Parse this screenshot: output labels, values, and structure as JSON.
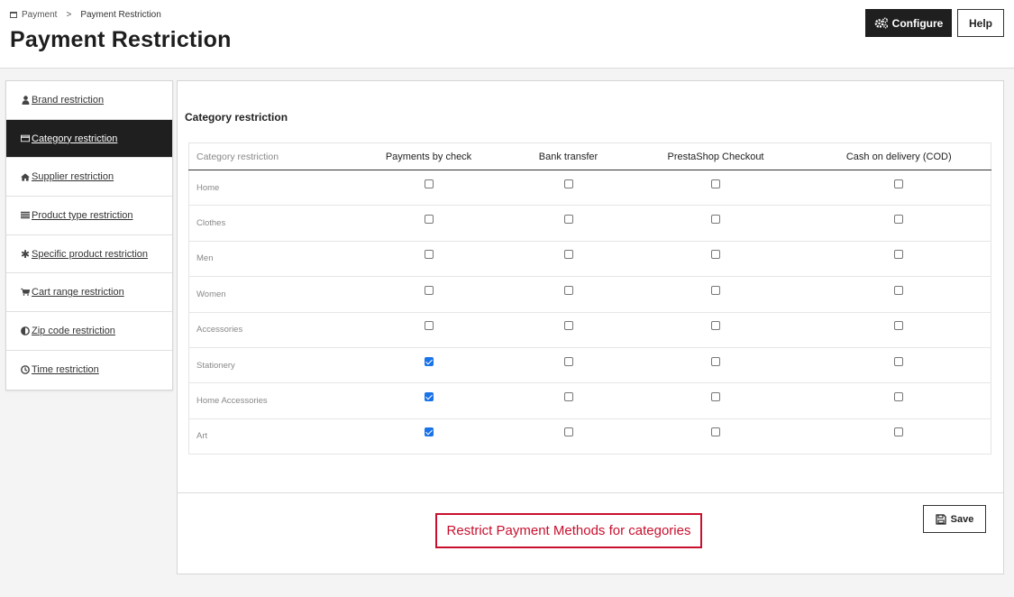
{
  "breadcrumb": {
    "parent": "Payment",
    "separator": ">",
    "current": "Payment Restriction"
  },
  "page_title": "Payment Restriction",
  "toolbar": {
    "configure_label": "Configure",
    "help_label": "Help"
  },
  "sidebar": {
    "items": [
      {
        "label": "Brand restriction",
        "icon": "user-icon",
        "active": false
      },
      {
        "label": "Category restriction",
        "icon": "credit-card-icon",
        "active": true
      },
      {
        "label": "Supplier restriction",
        "icon": "home-icon",
        "active": false
      },
      {
        "label": "Product type restriction",
        "icon": "list-icon",
        "active": false
      },
      {
        "label": "Specific product restriction",
        "icon": "asterisk-icon",
        "active": false
      },
      {
        "label": "Cart range restriction",
        "icon": "cart-icon",
        "active": false
      },
      {
        "label": "Zip code restriction",
        "icon": "half-circle-icon",
        "active": false
      },
      {
        "label": "Time restriction",
        "icon": "clock-icon",
        "active": false
      }
    ]
  },
  "panel": {
    "heading": "Category restriction",
    "columns": [
      "Category restriction",
      "Payments by check",
      "Bank transfer",
      "PrestaShop Checkout",
      "Cash on delivery (COD)"
    ],
    "rows": [
      {
        "name": "Home",
        "checks": [
          false,
          false,
          false,
          false
        ]
      },
      {
        "name": "Clothes",
        "checks": [
          false,
          false,
          false,
          false
        ]
      },
      {
        "name": "Men",
        "checks": [
          false,
          false,
          false,
          false
        ]
      },
      {
        "name": "Women",
        "checks": [
          false,
          false,
          false,
          false
        ]
      },
      {
        "name": "Accessories",
        "checks": [
          false,
          false,
          false,
          false
        ]
      },
      {
        "name": "Stationery",
        "checks": [
          true,
          false,
          false,
          false
        ]
      },
      {
        "name": "Home Accessories",
        "checks": [
          true,
          false,
          false,
          false
        ]
      },
      {
        "name": "Art",
        "checks": [
          true,
          false,
          false,
          false
        ]
      }
    ],
    "note": "Restrict Payment Methods for categories",
    "save_label": "Save"
  },
  "colors": {
    "accent_dark": "#1f1f1f",
    "checkbox_checked": "#1a73e8",
    "note_red": "#c8102e"
  }
}
